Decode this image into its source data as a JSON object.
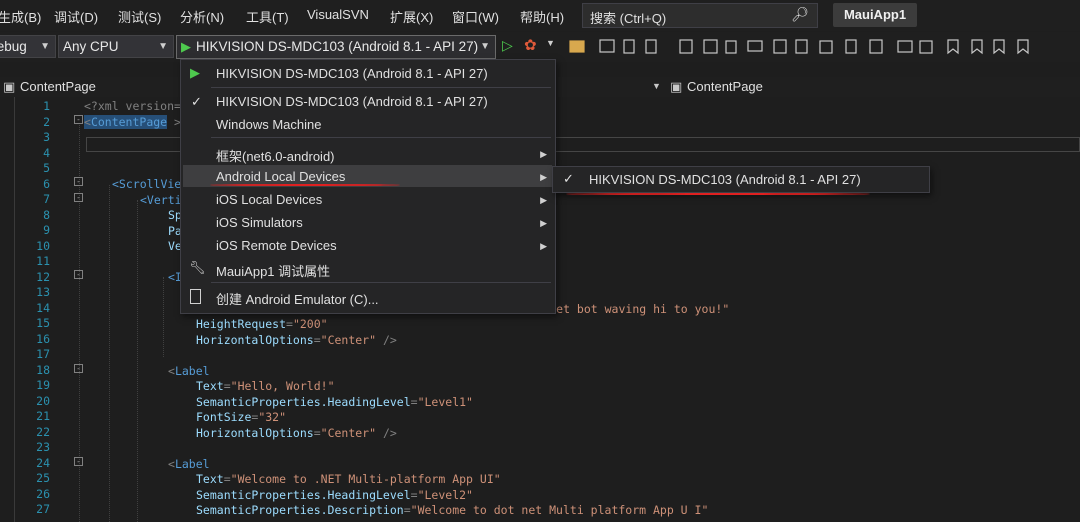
{
  "menubar": {
    "items": [
      "生成(B)",
      "调试(D)",
      "测试(S)",
      "分析(N)",
      "工具(T)",
      "VisualSVN",
      "扩展(X)",
      "窗口(W)",
      "帮助(H)"
    ],
    "search_placeholder": "搜索 (Ctrl+Q)",
    "app_title": "MauiApp1"
  },
  "toolbar": {
    "config": "Debug",
    "platform": "Any CPU",
    "run_target": "HIKVISION DS-MDC103 (Android 8.1 - API 27)"
  },
  "tabs": {
    "left": "ContentPage",
    "right": "ContentPage"
  },
  "dropdown": {
    "run_item": "HIKVISION DS-MDC103 (Android 8.1 - API 27)",
    "checked_item": "HIKVISION DS-MDC103 (Android 8.1 - API 27)",
    "windows": "Windows Machine",
    "framework": "框架(net6.0-android)",
    "android_local": "Android Local Devices",
    "ios_local": "iOS Local Devices",
    "ios_sim": "iOS Simulators",
    "ios_remote": "iOS Remote Devices",
    "debug_props": "MauiApp1 调试属性",
    "create_emulator": "创建 Android Emulator (C)..."
  },
  "submenu": {
    "device": "HIKVISION DS-MDC103 (Android 8.1 - API 27)"
  },
  "editor": {
    "line_numbers": [
      "1",
      "2",
      "3",
      "4",
      "5",
      "6",
      "7",
      "8",
      "9",
      "10",
      "11",
      "12",
      "13",
      "14",
      "15",
      "16",
      "17",
      "18",
      "19",
      "20",
      "21",
      "22",
      "23",
      "24",
      "25",
      "26",
      "27"
    ],
    "lines": {
      "l1": "<?xml version=",
      "l2_tag": "ContentPage",
      "l6": "<ScrollVie",
      "l7": "<Verti",
      "l8": "Sp",
      "l9": "Pa",
      "l10": "Ve",
      "l12": "<I",
      "l14_val": "\"Cute dot net bot waving hi to you!\"",
      "l15_attr": "HeightRequest",
      "l15_val": "\"200\"",
      "l16_attr": "HorizontalOptions",
      "l16_val": "\"Center\"",
      "l16_end": " />",
      "l18_tag": "Label",
      "l19_attr": "Text",
      "l19_val": "\"Hello, World!\"",
      "l20_attr": "SemanticProperties.HeadingLevel",
      "l20_val": "\"Level1\"",
      "l21_attr": "FontSize",
      "l21_val": "\"32\"",
      "l22_attr": "HorizontalOptions",
      "l22_val": "\"Center\"",
      "l22_end": " />",
      "l24_tag": "Label",
      "l25_attr": "Text",
      "l25_val": "\"Welcome to .NET Multi-platform App UI\"",
      "l26_attr": "SemanticProperties.HeadingLevel",
      "l26_val": "\"Level2\"",
      "l27_attr": "SemanticProperties.Description",
      "l27_val": "\"Welcome to dot net Multi platform App U I\""
    }
  },
  "colors": {
    "accent_run": "#4ec94e",
    "underline": "#e02020"
  }
}
